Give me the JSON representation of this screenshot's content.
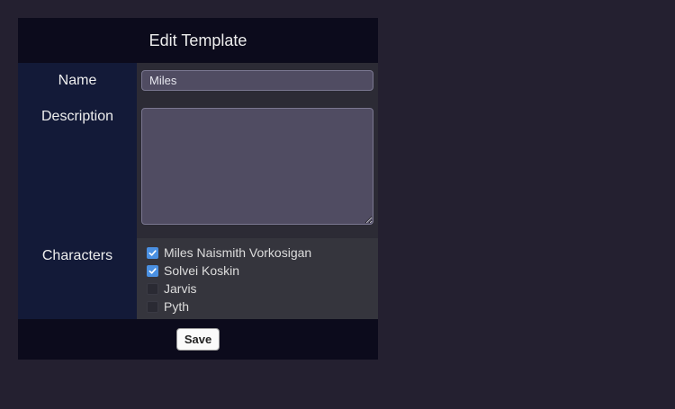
{
  "form": {
    "title": "Edit Template",
    "name_label": "Name",
    "name_value": "Miles",
    "description_label": "Description",
    "description_value": "",
    "characters_label": "Characters",
    "characters": [
      {
        "label": "Miles Naismith Vorkosigan",
        "checked": true
      },
      {
        "label": "Solvei Koskin",
        "checked": true
      },
      {
        "label": "Jarvis",
        "checked": false
      },
      {
        "label": "Pyth",
        "checked": false
      }
    ],
    "save_label": "Save"
  },
  "colors": {
    "page_bg": "#242030",
    "panel_bg": "#0c0b1c",
    "label_bg": "#131a38",
    "checkbox_accent": "#4a90e2"
  }
}
